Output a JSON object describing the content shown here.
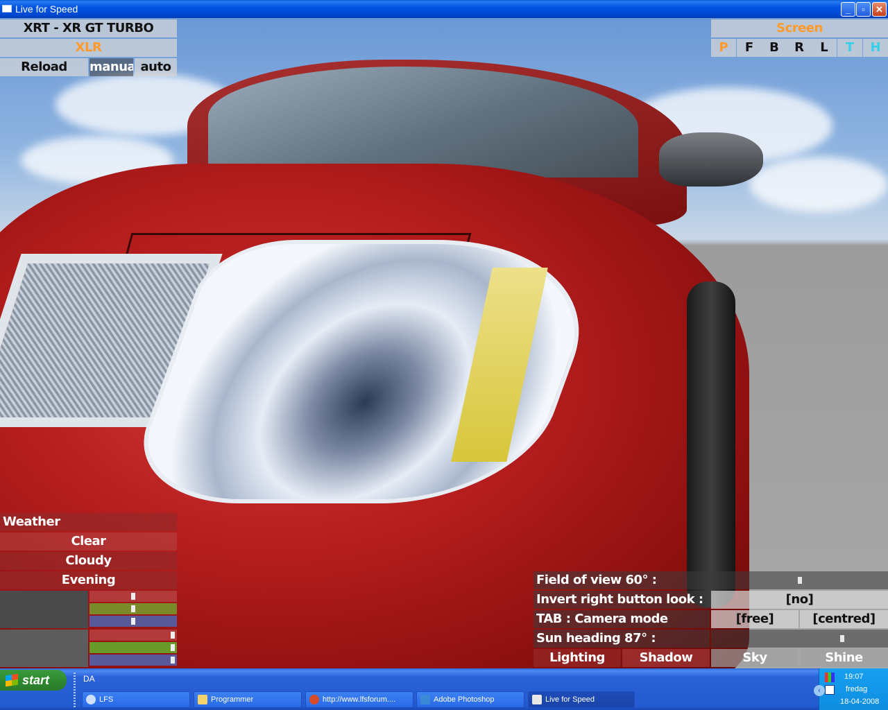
{
  "window": {
    "title": "Live for Speed"
  },
  "car_panel": {
    "car_name": "XRT - XR GT TURBO",
    "car_code": "XLR",
    "reload": "Reload",
    "manual": "manual",
    "auto": "auto"
  },
  "screen_panel": {
    "label": "Screen",
    "letters": [
      "P",
      "F",
      "B",
      "R",
      "L",
      "T",
      "H"
    ]
  },
  "weather": {
    "header": "Weather",
    "options": [
      "Clear",
      "Cloudy",
      "Evening"
    ]
  },
  "color_sliders": {
    "group1": [
      {
        "color": "#b23a3a",
        "level": 0.5
      },
      {
        "color": "#7a8a2a",
        "level": 0.5
      },
      {
        "color": "#5a5a9a",
        "level": 0.5
      }
    ],
    "group2": [
      {
        "color": "#b23a3a",
        "level": 0.95
      },
      {
        "color": "#6a9a2a",
        "level": 0.95
      },
      {
        "color": "#5a5a9a",
        "level": 0.95
      }
    ]
  },
  "view_options": {
    "fov_label": "Field of view 60° :",
    "fov_level": 0.5,
    "invert_label": "Invert right button look :",
    "invert_value": "[no]",
    "tab_label": "TAB : Camera mode",
    "mode_free": "[free]",
    "mode_centred": "[centred]",
    "sun_label": "Sun heading 87° :",
    "sun_level": 0.74,
    "tabs": [
      "Lighting",
      "Shadow",
      "Sky",
      "Shine"
    ]
  },
  "taskbar": {
    "start": "start",
    "quicklaunch": "DA",
    "tasks": [
      {
        "label": "LFS",
        "icon": "help-icon"
      },
      {
        "label": "Programmer",
        "icon": "folder-icon"
      },
      {
        "label": "http://www.lfsforum....",
        "icon": "browser-icon"
      },
      {
        "label": "Adobe Photoshop",
        "icon": "photoshop-icon"
      },
      {
        "label": "Live for Speed",
        "icon": "lfs-icon"
      }
    ],
    "clock": "19:07",
    "day": "fredag",
    "date": "18-04-2008"
  },
  "colors": {
    "accent_orange": "#ff9a2a",
    "accent_cyan": "#35d0e8",
    "xp_blue": "#0054e3"
  }
}
